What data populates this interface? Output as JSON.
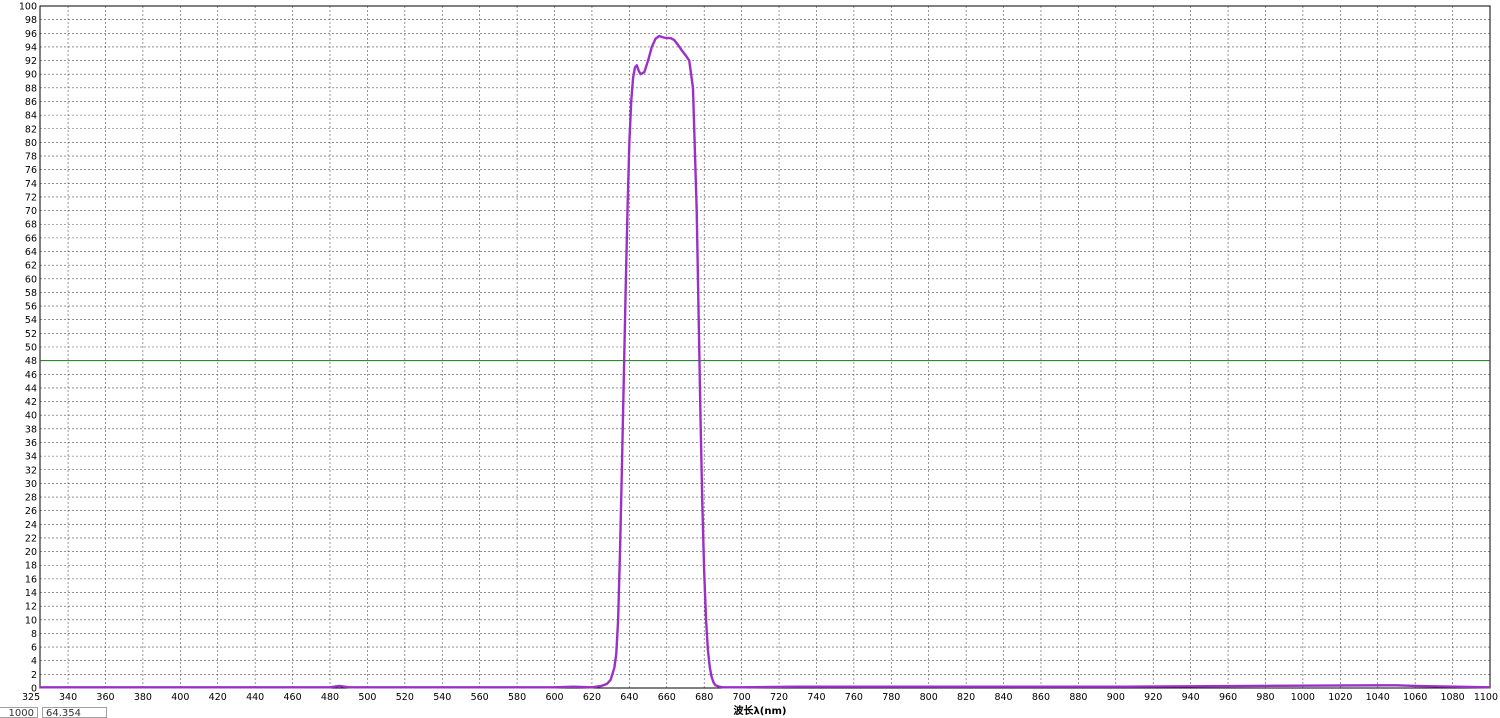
{
  "chart_data": {
    "type": "line",
    "title": "",
    "xlabel": "波长λ(nm)",
    "ylabel": "",
    "xlim": [
      325,
      1100
    ],
    "ylim": [
      0,
      100
    ],
    "grid": true,
    "x_ticks": [
      "325",
      "340",
      "360",
      "380",
      "400",
      "420",
      "440",
      "460",
      "480",
      "500",
      "520",
      "540",
      "560",
      "580",
      "600",
      "620",
      "640",
      "660",
      "680",
      "700",
      "720",
      "740",
      "760",
      "780",
      "800",
      "820",
      "840",
      "860",
      "880",
      "900",
      "920",
      "940",
      "960",
      "980",
      "1000",
      "1020",
      "1040",
      "1060",
      "1080",
      "1100"
    ],
    "y_ticks": [
      "0",
      "2",
      "4",
      "6",
      "8",
      "10",
      "12",
      "14",
      "16",
      "18",
      "20",
      "22",
      "24",
      "26",
      "28",
      "30",
      "32",
      "34",
      "36",
      "38",
      "40",
      "42",
      "44",
      "46",
      "48",
      "50",
      "52",
      "54",
      "56",
      "58",
      "60",
      "62",
      "64",
      "66",
      "68",
      "70",
      "72",
      "74",
      "76",
      "78",
      "80",
      "82",
      "84",
      "86",
      "88",
      "90",
      "92",
      "94",
      "96",
      "98",
      "100"
    ],
    "reference_line": {
      "y": 48,
      "color": "#1a7a1a"
    },
    "series": [
      {
        "color": "#9b30c8",
        "x": [
          325,
          400,
          480,
          485,
          490,
          600,
          610,
          620,
          625,
          628,
          630,
          632,
          633,
          634,
          635,
          636,
          637,
          638,
          639,
          640,
          641,
          642,
          643,
          644,
          645,
          646,
          648,
          650,
          652,
          654,
          656,
          658,
          660,
          662,
          664,
          666,
          668,
          670,
          672,
          674,
          676,
          677,
          678,
          679,
          680,
          681,
          682,
          683,
          684,
          685,
          686,
          688,
          690,
          700,
          730,
          820,
          860,
          905,
          1040,
          1050,
          1060,
          1100
        ],
        "y": [
          0.1,
          0.1,
          0.1,
          0.3,
          0.1,
          0.1,
          0.2,
          0.1,
          0.3,
          0.6,
          1.2,
          3.0,
          5.0,
          10.0,
          20.0,
          32.0,
          45.0,
          58.0,
          70.0,
          80.0,
          86.0,
          89.5,
          91.0,
          91.3,
          90.5,
          90.0,
          90.3,
          92.0,
          94.0,
          95.2,
          95.6,
          95.4,
          95.3,
          95.3,
          95.0,
          94.3,
          93.5,
          92.8,
          92.0,
          88.0,
          70.0,
          55.0,
          40.0,
          27.0,
          17.0,
          10.0,
          5.5,
          3.0,
          1.6,
          0.8,
          0.4,
          0.2,
          0.1,
          0.1,
          0.2,
          0.2,
          0.2,
          0.2,
          0.4,
          0.4,
          0.3,
          0.1
        ]
      }
    ]
  },
  "readouts": {
    "left_value": "1000",
    "cursor_value": "64.354"
  }
}
